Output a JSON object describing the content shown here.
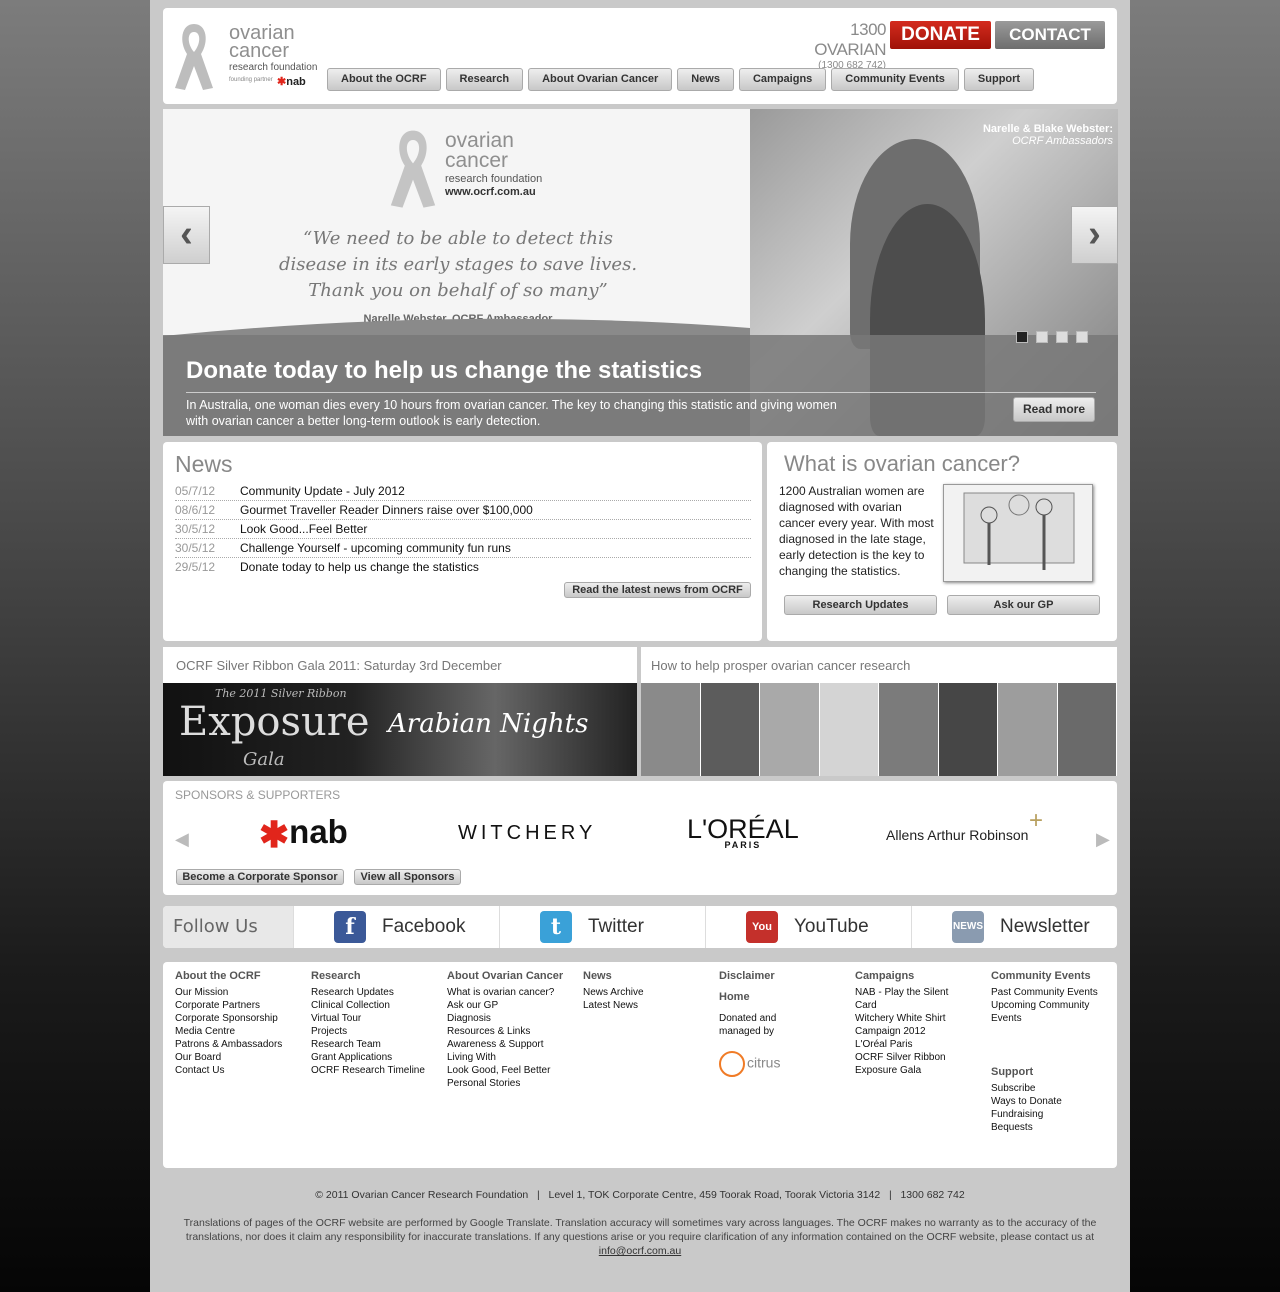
{
  "header": {
    "logo": {
      "line1": "ovarian",
      "line2": "cancer",
      "line3": "research foundation",
      "founding": "founding partner",
      "partner": "nab"
    },
    "phone": "1300 OVARIAN",
    "phone_digits": "(1300 682 742)",
    "donate_label": "DONATE",
    "contact_label": "CONTACT US",
    "nav": [
      "About the OCRF",
      "Research",
      "About Ovarian Cancer",
      "News",
      "Campaigns",
      "Community Events",
      "Support"
    ]
  },
  "slider": {
    "logo": {
      "line1": "ovarian",
      "line2": "cancer",
      "line3": "research foundation",
      "url": "www.ocrf.com.au"
    },
    "quote": "“We need to be able to detect this disease in its early stages to save lives. Thank you on behalf of so many”",
    "quote_by": "Narelle Webster, OCRF Ambassador",
    "ambassador_names": "Narelle & Blake Webster:",
    "ambassador_role": "OCRF Ambassadors",
    "caption_title": "Donate today to help us change the statistics",
    "caption_text": "In Australia, one woman dies every 10 hours from ovarian cancer. The key to changing this statistic and giving women with ovarian cancer a better long-term outlook is early detection.",
    "read_more": "Read more",
    "prev_icon": "‹",
    "next_icon": "›",
    "active_dot": 0
  },
  "news": {
    "title": "News",
    "items": [
      {
        "date": "05/7/12",
        "title": "Community Update - July 2012"
      },
      {
        "date": "08/6/12",
        "title": "Gourmet Traveller Reader Dinners raise over $100,000"
      },
      {
        "date": "30/5/12",
        "title": "Look Good...Feel Better"
      },
      {
        "date": "30/5/12",
        "title": "Challenge Yourself - upcoming community fun runs"
      },
      {
        "date": "29/5/12",
        "title": "Donate today to help us change the statistics"
      }
    ],
    "button": "Read the latest news from OCRF"
  },
  "what": {
    "title": "What is ovarian cancer?",
    "text": "1200 Australian women are diagnosed with ovarian cancer every year. With most diagnosed in the late stage, early detection is the key to changing the statistics.",
    "btn_research": "Research Updates",
    "btn_gp": "Ask our GP"
  },
  "gala": {
    "title": "OCRF Silver Ribbon Gala 2011: Saturday 3rd December",
    "banner_top": "The 2011 Silver Ribbon",
    "banner_main": "Exposure",
    "banner_sub": "Gala",
    "banner_theme": "Arabian Nights"
  },
  "help": {
    "title": "How to help prosper ovarian cancer research"
  },
  "sponsors": {
    "title": "SPONSORS & SUPPORTERS",
    "logos": {
      "nab": "nab",
      "witchery": "WITCHERY",
      "loreal": "L'ORÉAL",
      "loreal_sub": "PARIS",
      "allens": "Allens Arthur Robinson"
    },
    "btn_become": "Become a Corporate Sponsor",
    "btn_all": "View all Sponsors"
  },
  "follow": {
    "label": "Follow Us",
    "facebook": "Facebook",
    "twitter": "Twitter",
    "youtube": "YouTube",
    "newsletter": "Newsletter",
    "colors": {
      "facebook": "#3b5998",
      "twitter": "#3aa1d8",
      "youtube": "#c4302b",
      "newsletter": "#8a9bb0"
    }
  },
  "footer": {
    "about": {
      "heading": "About the OCRF",
      "links": [
        "Our Mission",
        "Corporate Partners",
        "Corporate Sponsorship",
        "Media Centre",
        "Patrons & Ambassadors",
        "Our Board",
        "Contact Us"
      ]
    },
    "research": {
      "heading": "Research",
      "links": [
        "Research Updates",
        "Clinical Collection",
        "Virtual Tour",
        "Projects",
        "Research Team",
        "Grant Applications",
        "OCRF Research Timeline"
      ]
    },
    "aboutoc": {
      "heading": "About Ovarian Cancer",
      "links": [
        "What is ovarian cancer?",
        "Ask our GP",
        "Diagnosis",
        "Resources & Links",
        "Awareness & Support",
        "Living With",
        "Look Good, Feel Better",
        "Personal Stories"
      ]
    },
    "news": {
      "heading": "News",
      "links": [
        "News Archive",
        "Latest News"
      ]
    },
    "disclaimer": "Disclaimer",
    "home": "Home",
    "donated": "Donated and managed by",
    "citrus": "citrus",
    "campaigns": {
      "heading": "Campaigns",
      "links": [
        "NAB - Play the Silent Card",
        "Witchery White Shirt Campaign 2012",
        "L'Oréal Paris",
        "OCRF Silver Ribbon Exposure Gala"
      ]
    },
    "community": {
      "heading": "Community Events",
      "links": [
        "Past Community Events",
        "Upcoming Community Events"
      ]
    },
    "support": {
      "heading": "Support",
      "links": [
        "Subscribe",
        "Ways to Donate",
        "Fundraising",
        "Bequests"
      ]
    }
  },
  "bottom": {
    "copyright": "© 2011 Ovarian Cancer Research Foundation   |   Level 1, TOK Corporate Centre, 459 Toorak Road, Toorak Victoria 3142   |   1300 682 742",
    "disclaimer": "Translations of pages of the OCRF website are performed by Google Translate. Translation accuracy will sometimes vary across languages. The OCRF makes no warranty as to the accuracy of the translations, nor does it claim any responsibility for inaccurate translations. If any questions arise or you require clarification of any information contained on the OCRF website, please contact us at",
    "email": "info@ocrf.com.au"
  }
}
